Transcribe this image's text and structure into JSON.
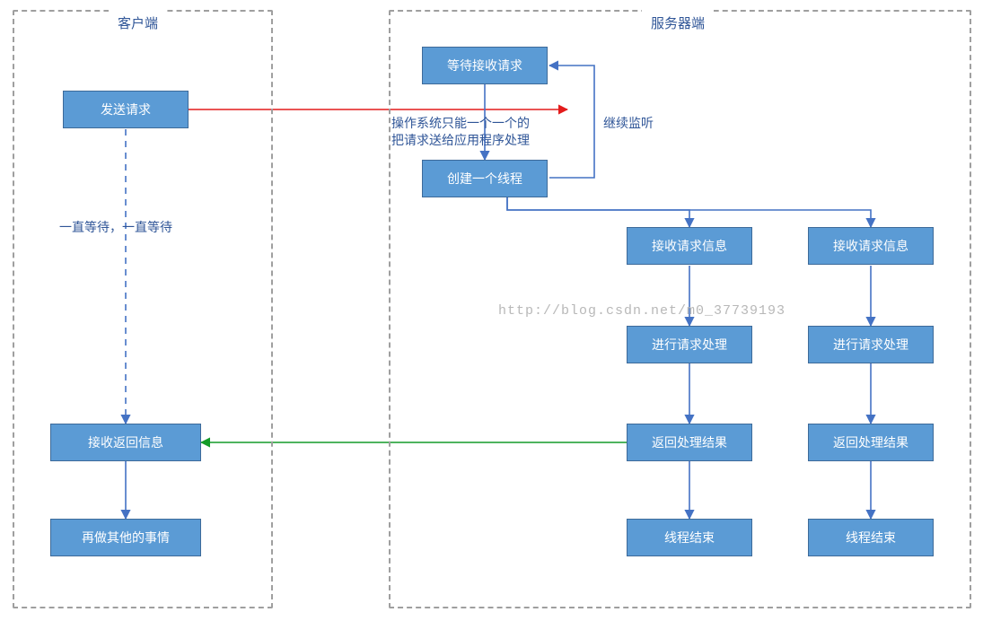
{
  "panels": {
    "client": {
      "title": "客户端"
    },
    "server": {
      "title": "服务器端"
    }
  },
  "nodes": {
    "send_request": "发送请求",
    "recv_response": "接收返回信息",
    "do_other": "再做其他的事情",
    "wait_request": "等待接收请求",
    "create_thread": "创建一个线程",
    "recv_req_info_1": "接收请求信息",
    "process_req_1": "进行请求处理",
    "return_result_1": "返回处理结果",
    "thread_end_1": "线程结束",
    "recv_req_info_2": "接收请求信息",
    "process_req_2": "进行请求处理",
    "return_result_2": "返回处理结果",
    "thread_end_2": "线程结束"
  },
  "edge_labels": {
    "os_note_line1": "操作系统只能一个一个的",
    "os_note_line2": "把请求送给应用程序处理",
    "keep_listening": "继续监听",
    "keep_waiting": "一直等待，一直等待"
  },
  "watermark": "http://blog.csdn.net/m0_37739193",
  "chart_data": {
    "type": "flowchart",
    "clusters": [
      {
        "id": "client",
        "label": "客户端",
        "nodes": [
          "send_request",
          "recv_response",
          "do_other"
        ]
      },
      {
        "id": "server",
        "label": "服务器端",
        "nodes": [
          "wait_request",
          "create_thread",
          "recv_req_info_1",
          "process_req_1",
          "return_result_1",
          "thread_end_1",
          "recv_req_info_2",
          "process_req_2",
          "return_result_2",
          "thread_end_2"
        ]
      }
    ],
    "nodes": [
      {
        "id": "send_request",
        "label": "发送请求"
      },
      {
        "id": "recv_response",
        "label": "接收返回信息"
      },
      {
        "id": "do_other",
        "label": "再做其他的事情"
      },
      {
        "id": "wait_request",
        "label": "等待接收请求"
      },
      {
        "id": "create_thread",
        "label": "创建一个线程"
      },
      {
        "id": "recv_req_info_1",
        "label": "接收请求信息"
      },
      {
        "id": "process_req_1",
        "label": "进行请求处理"
      },
      {
        "id": "return_result_1",
        "label": "返回处理结果"
      },
      {
        "id": "thread_end_1",
        "label": "线程结束"
      },
      {
        "id": "recv_req_info_2",
        "label": "接收请求信息"
      },
      {
        "id": "process_req_2",
        "label": "进行请求处理"
      },
      {
        "id": "return_result_2",
        "label": "返回处理结果"
      },
      {
        "id": "thread_end_2",
        "label": "线程结束"
      }
    ],
    "edges": [
      {
        "from": "send_request",
        "to": "wait_request",
        "style": "solid",
        "color": "red",
        "label": "操作系统只能一个一个的\n把请求送给应用程序处理"
      },
      {
        "from": "send_request",
        "to": "recv_response",
        "style": "dashed",
        "color": "blue",
        "label": "一直等待，一直等待"
      },
      {
        "from": "recv_response",
        "to": "do_other",
        "style": "solid",
        "color": "blue"
      },
      {
        "from": "wait_request",
        "to": "create_thread",
        "style": "solid",
        "color": "blue"
      },
      {
        "from": "create_thread",
        "to": "wait_request",
        "style": "solid",
        "color": "blue",
        "label": "继续监听"
      },
      {
        "from": "create_thread",
        "to": "recv_req_info_1",
        "style": "solid",
        "color": "blue"
      },
      {
        "from": "create_thread",
        "to": "recv_req_info_2",
        "style": "solid",
        "color": "blue"
      },
      {
        "from": "recv_req_info_1",
        "to": "process_req_1",
        "style": "solid",
        "color": "blue"
      },
      {
        "from": "process_req_1",
        "to": "return_result_1",
        "style": "solid",
        "color": "blue"
      },
      {
        "from": "return_result_1",
        "to": "thread_end_1",
        "style": "solid",
        "color": "blue"
      },
      {
        "from": "recv_req_info_2",
        "to": "process_req_2",
        "style": "solid",
        "color": "blue"
      },
      {
        "from": "process_req_2",
        "to": "return_result_2",
        "style": "solid",
        "color": "blue"
      },
      {
        "from": "return_result_2",
        "to": "thread_end_2",
        "style": "solid",
        "color": "blue"
      },
      {
        "from": "return_result_1",
        "to": "recv_response",
        "style": "solid",
        "color": "green"
      }
    ]
  }
}
